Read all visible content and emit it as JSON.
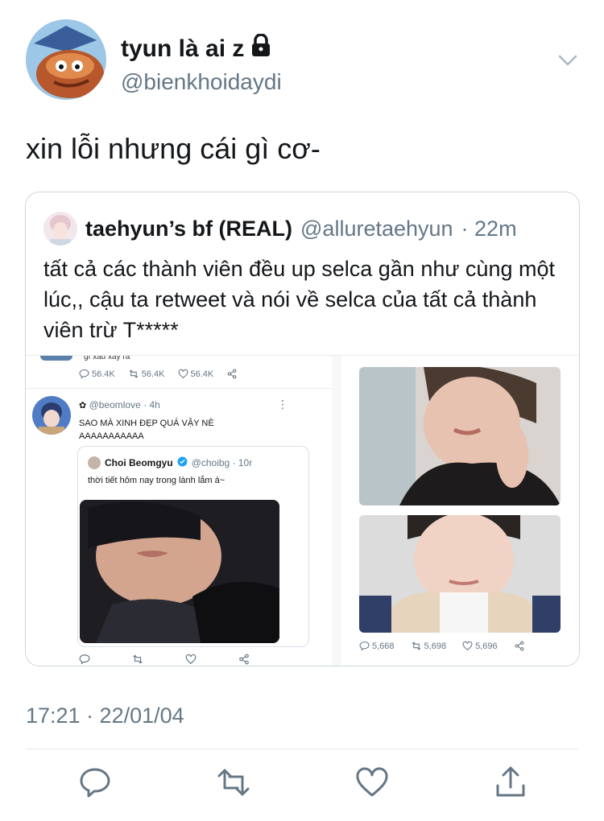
{
  "tweet": {
    "display_name": "tyun là ai z",
    "handle": "@bienkhoidaydi",
    "text": "xin lỗi nhưng cái gì cơ-",
    "timestamp": "17:21 · 22/01/04"
  },
  "quoted": {
    "display_name": "taehyun’s bf (REAL)",
    "handle": "@alluretaehyun",
    "time": "· 22m",
    "text": "tất cả các thành viên đều up selca gần như cùng một lúc,, cậu ta retweet và nói về selca của tất cả thành viên trừ T*****"
  },
  "embedded_screenshot": {
    "prev_line": "gì xấu xảy ra",
    "prev_stats": [
      "56.4K",
      "56.4K",
      "56.4K"
    ],
    "user_handle": "@beomlove · 4h",
    "user_text": "SAO MÀ XINH ĐẸP QUÁ VẬY NÈ AAAAAAAAAAA",
    "inner_name": "Choi Beomgyu",
    "inner_handle": "@choibg · 10r",
    "inner_text": "thời tiết hôm nay trong lành lắm á~",
    "right_stats": [
      "5,668",
      "5,698",
      "5,696"
    ]
  },
  "icons": {
    "lock": "lock-icon",
    "chevron": "chevron-down-icon",
    "reply": "reply-icon",
    "retweet": "retweet-icon",
    "like": "like-icon",
    "share": "share-icon"
  },
  "colors": {
    "text_primary": "#14171a",
    "text_secondary": "#657786",
    "border": "#ccd6dd",
    "verified": "#1da1f2"
  }
}
